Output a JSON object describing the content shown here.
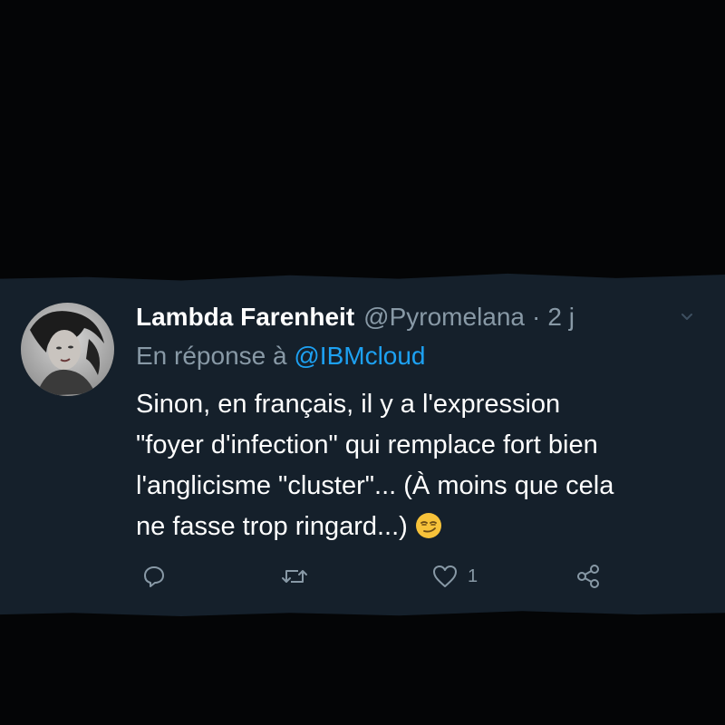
{
  "tweet": {
    "display_name": "Lambda Farenheit",
    "handle": "@Pyromelana",
    "separator": "·",
    "time": "2 j",
    "reply_prefix": "En réponse à",
    "reply_to": "@IBMcloud",
    "text_lines": [
      "Sinon, en français, il y a l'expression",
      "\"foyer d'infection\" qui remplace fort bien",
      "l'anglicisme \"cluster\"... (À moins que cela",
      "ne fasse trop ringard...)"
    ],
    "emoji": "smirking-face",
    "actions": {
      "reply_icon": "reply-icon",
      "retweet_icon": "retweet-icon",
      "like_icon": "heart-icon",
      "like_count": "1",
      "share_icon": "share-icon"
    }
  },
  "colors": {
    "card_background": "#15202b",
    "page_background": "#040506",
    "text_primary": "#ffffff",
    "text_secondary": "#8899a6",
    "link": "#1da1f2"
  }
}
